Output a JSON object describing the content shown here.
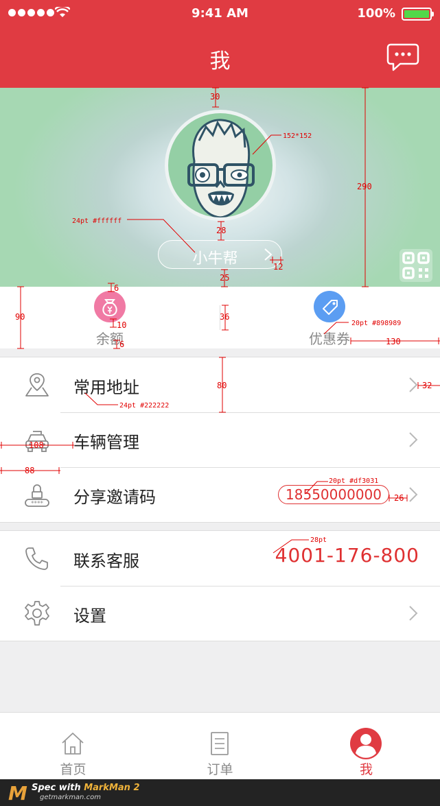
{
  "status_bar": {
    "time": "9:41 AM",
    "battery": "100%"
  },
  "nav": {
    "title": "我"
  },
  "profile": {
    "name": "小牛帮"
  },
  "wallet": {
    "balance_label": "余额",
    "coupon_label": "优惠券"
  },
  "menu1": {
    "address": "常用地址",
    "vehicle": "车辆管理",
    "invite": "分享邀请码",
    "invite_code": "18550000000"
  },
  "menu2": {
    "service": "联系客服",
    "service_phone": "4001-176-800",
    "settings": "设置"
  },
  "tabs": {
    "home": "首页",
    "orders": "订单",
    "me": "我"
  },
  "footer": {
    "prefix": "Spec with ",
    "brand": "MarkMan 2",
    "site": "getmarkman.com",
    "logo": "M"
  },
  "annotations": {
    "a30": "30",
    "avatar_size": "152*152",
    "a290": "290",
    "name_font": "24pt #ffffff",
    "a28": "28",
    "a12": "12",
    "a25": "25",
    "a6a": "6",
    "a90": "90",
    "a10": "10",
    "a36": "36",
    "label_font": "20pt #898989",
    "a6b": "6",
    "a130": "130",
    "a80": "80",
    "a32": "32",
    "row_font": "24pt #222222",
    "a108": "108",
    "a88": "88",
    "code_font": "20pt #df3031",
    "a26": "26",
    "phone_font": "28pt"
  },
  "colors": {
    "brand_red": "#e03b42",
    "accent_red": "#df3031",
    "label_gray": "#898989",
    "text_dark": "#222222",
    "balance_pink": "#f07aa4",
    "coupon_blue": "#5b9df2"
  }
}
